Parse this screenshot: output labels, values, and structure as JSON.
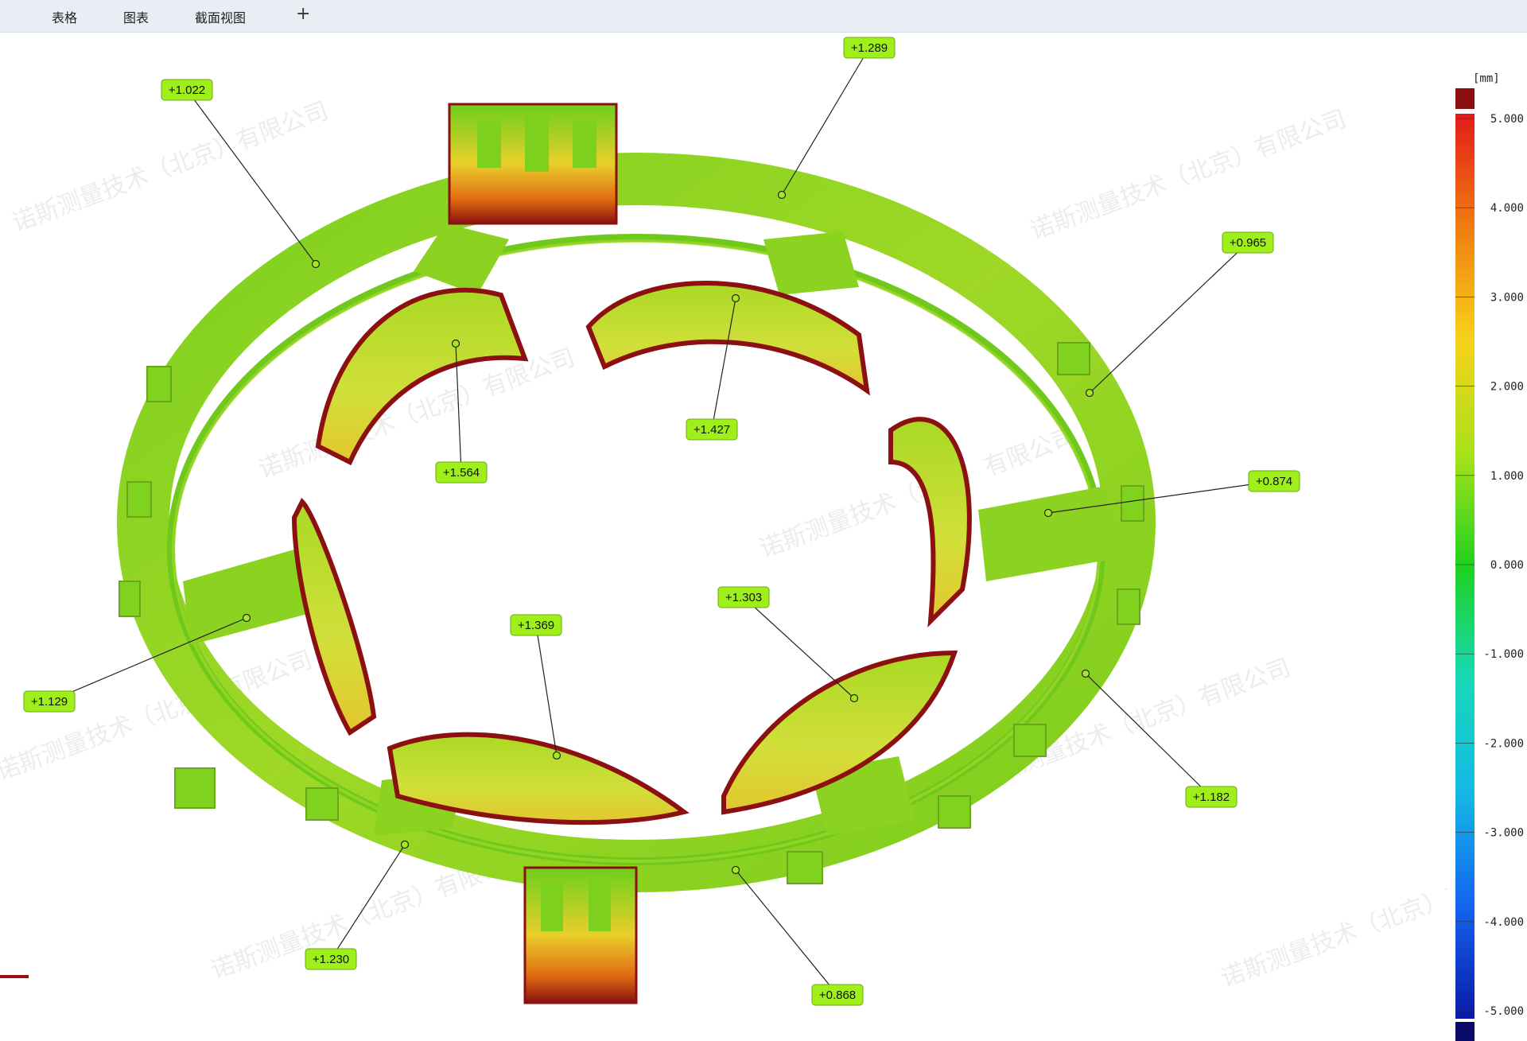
{
  "tabs": [
    {
      "label": "表格"
    },
    {
      "label": "图表"
    },
    {
      "label": "截面视图"
    }
  ],
  "add_tab_symbol": "+",
  "color_scale": {
    "unit": "[mm]",
    "ticks": [
      "5.000",
      "4.000",
      "3.000",
      "2.000",
      "1.000",
      "0.000",
      "-1.000",
      "-2.000",
      "-3.000",
      "-4.000",
      "-5.000"
    ],
    "max_color": "#8b0f0f",
    "min_color": "#0b0b6b",
    "gradient_colors": [
      "#e31b1b",
      "#f07d0f",
      "#f7d21a",
      "#a9e21a",
      "#1fd11f",
      "#17d9b8",
      "#14b9e6",
      "#1464ef",
      "#0a1aa6"
    ]
  },
  "callouts": [
    {
      "label": "+1.022"
    },
    {
      "label": "+1.289"
    },
    {
      "label": "+0.965"
    },
    {
      "label": "+1.564"
    },
    {
      "label": "+1.427"
    },
    {
      "label": "+0.874"
    },
    {
      "label": "+1.129"
    },
    {
      "label": "+1.369"
    },
    {
      "label": "+1.303"
    },
    {
      "label": "+1.182"
    },
    {
      "label": "+1.230"
    },
    {
      "label": "+0.868"
    }
  ],
  "watermark": "诺斯测量技术（北京）有限公司",
  "colors": {
    "part_green": "#7fd21e",
    "part_yellow": "#d6e33a",
    "edge_red": "#8c1010",
    "callout_bg": "#9ff01a"
  }
}
